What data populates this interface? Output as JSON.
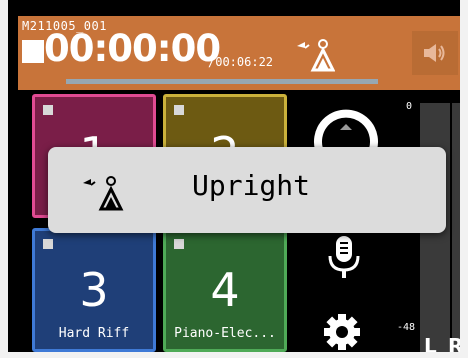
{
  "header": {
    "file_name": "M211005_001",
    "elapsed_time": "00:00:00",
    "total_time": "/00:06:22",
    "scene_icon": "upright-piano-scene-icon",
    "speaker_icon": "speaker-icon",
    "playback_progress": 0
  },
  "tracks": [
    {
      "number": "1",
      "name": "",
      "color": "#e14b93"
    },
    {
      "number": "2",
      "name": "",
      "color": "#cbb23b"
    },
    {
      "number": "3",
      "name": "Hard Riff",
      "color": "#3f7ad6"
    },
    {
      "number": "4",
      "name": "Piano-Elec...",
      "color": "#4faa57"
    }
  ],
  "controls": {
    "gauge_icon": "level-gauge-icon",
    "mic_icon": "microphone-icon",
    "settings_icon": "gear-icon"
  },
  "meter": {
    "top_label": "0",
    "bottom_label": "-48",
    "left_channel": "L",
    "right_channel": "R"
  },
  "popup": {
    "label": "Upright",
    "icon": "upright-piano-scene-icon"
  }
}
